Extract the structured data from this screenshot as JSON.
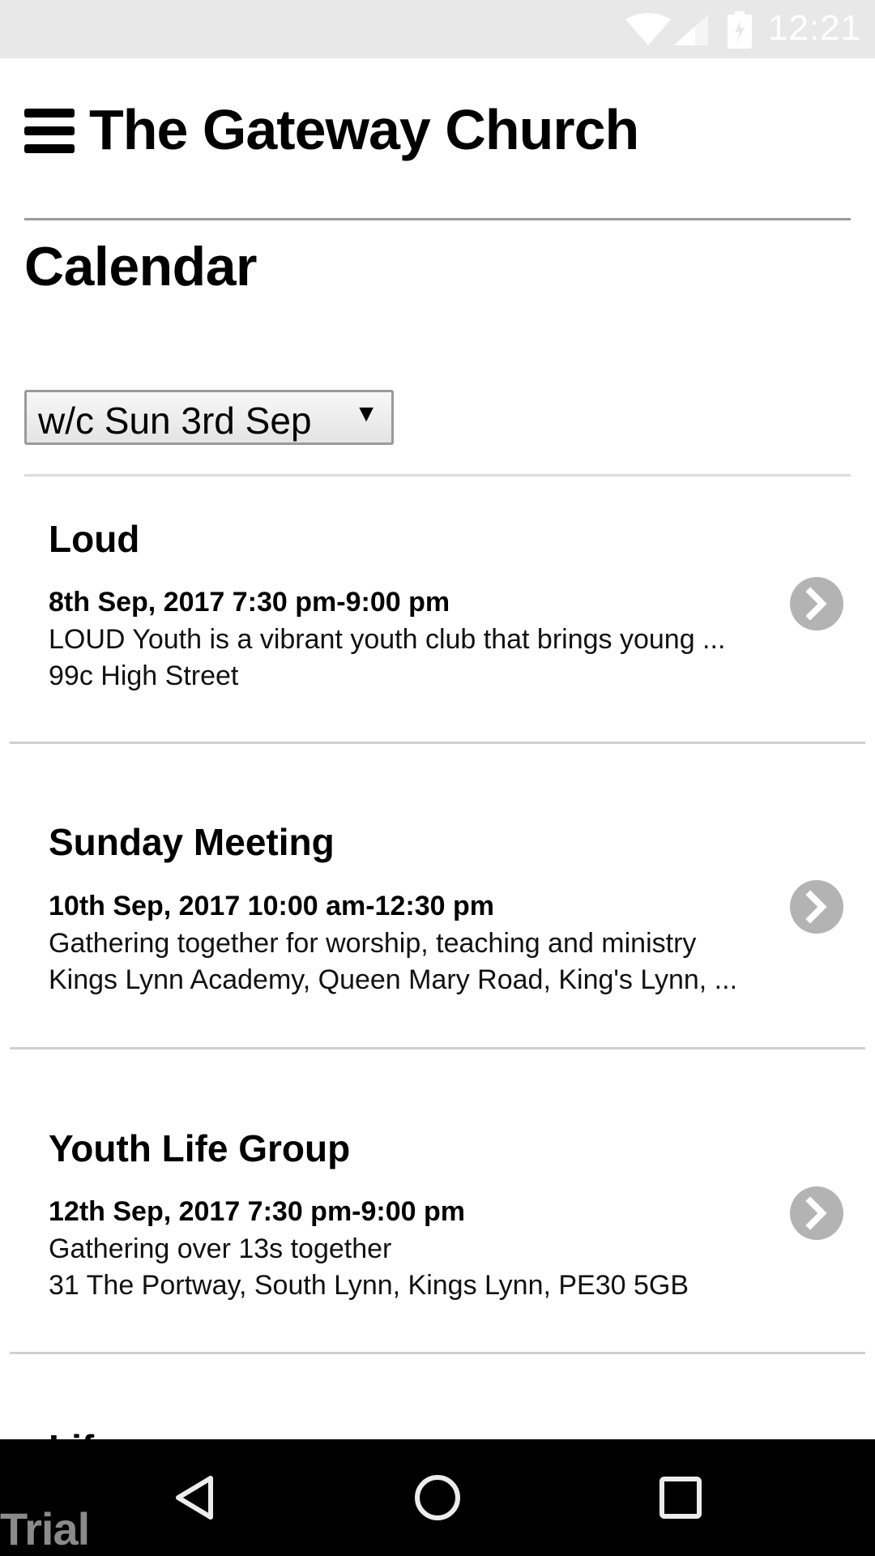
{
  "status_bar": {
    "time": "12:21",
    "icons": [
      "wifi-icon",
      "cell-signal-icon",
      "battery-charging-icon"
    ]
  },
  "header": {
    "menu_icon": "hamburger-menu-icon",
    "title": "The Gateway Church"
  },
  "page": {
    "title": "Calendar",
    "week_select": {
      "selected": "w/c Sun 3rd Sep",
      "arrow": "▼"
    }
  },
  "events": [
    {
      "name": "Loud",
      "when": "8th Sep, 2017 7:30 pm-9:00 pm",
      "description": "LOUD Youth is a vibrant youth club that brings young ...",
      "location": "99c High Street"
    },
    {
      "name": "Sunday Meeting",
      "when": "10th Sep, 2017 10:00 am-12:30 pm",
      "description": "Gathering together for worship, teaching and ministry",
      "location": "Kings Lynn Academy, Queen Mary Road, King's Lynn, ..."
    },
    {
      "name": "Youth Life Group",
      "when": "12th Sep, 2017 7:30 pm-9:00 pm",
      "description": "Gathering over 13s together",
      "location": "31 The Portway, South Lynn, Kings Lynn, PE30 5GB"
    }
  ],
  "partial_next_event": "Lif",
  "nav_bar": {
    "buttons": [
      "back",
      "home",
      "recents"
    ]
  },
  "watermark": "Trial",
  "colors": {
    "status_bar_bg": "#e8e8e8",
    "chevron_bg": "#b3b3b3",
    "divider": "#cfcfcf",
    "nav_bar_bg": "#000000"
  }
}
